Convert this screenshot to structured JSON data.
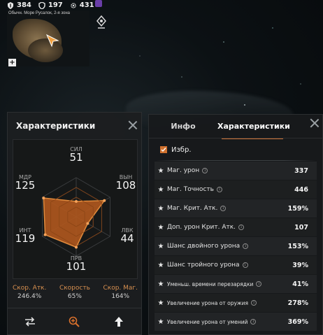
{
  "topbar": {
    "stat1": "384",
    "stat2": "197",
    "stat3": "431"
  },
  "minimap": {
    "title": "Обычн. Море Русалок, 2-я зона",
    "plus": "+"
  },
  "left_panel": {
    "title": "Характеристики",
    "axes": [
      {
        "key": "str",
        "label": "СИЛ",
        "value": "51"
      },
      {
        "key": "sta",
        "label": "ВЫН",
        "value": "108"
      },
      {
        "key": "dex",
        "label": "ЛВК",
        "value": "44"
      },
      {
        "key": "wis",
        "label": "ПРВ",
        "value": "101"
      },
      {
        "key": "int",
        "label": "ИНТ",
        "value": "119"
      },
      {
        "key": "spi",
        "label": "МДР",
        "value": "125"
      }
    ],
    "speeds": [
      {
        "label": "Скор. Атк.",
        "value": "246.4%"
      },
      {
        "label": "Скорость",
        "value": "65%"
      },
      {
        "label": "Скор. Маг.",
        "value": "164%"
      }
    ],
    "colors": {
      "radar_fill": "#b0581e",
      "radar_stroke": "#e08a3c"
    }
  },
  "right_panel": {
    "tabs": [
      {
        "label": "Инфо",
        "active": false
      },
      {
        "label": "Характеристики",
        "active": true
      }
    ],
    "favorites_label": "Избр.",
    "rows": [
      {
        "name": "Маг. урон",
        "value": "337"
      },
      {
        "name": "Маг. Точность",
        "value": "446"
      },
      {
        "name": "Маг. Крит. Атк.",
        "value": "159%"
      },
      {
        "name": "Доп. урон Крит. Атк.",
        "value": "107"
      },
      {
        "name": "Шанс двойного урона",
        "value": "153%"
      },
      {
        "name": "Шанс тройного урона",
        "value": "39%"
      },
      {
        "name": "Уменьш. времени перезарядки",
        "value": "41%"
      },
      {
        "name": "Увеличение урона от оружия",
        "value": "278%"
      },
      {
        "name": "Увеличение урона от умений",
        "value": "369%"
      }
    ],
    "accent": "#d0712e"
  },
  "icons": {
    "shield": "shield-icon",
    "defense": "defense-icon",
    "gear": "gear-icon",
    "star": "star-icon",
    "info": "info-icon",
    "close": "close-icon",
    "swap": "swap-arrows-icon",
    "zoom": "zoom-in-icon",
    "up": "arrow-up-icon"
  }
}
